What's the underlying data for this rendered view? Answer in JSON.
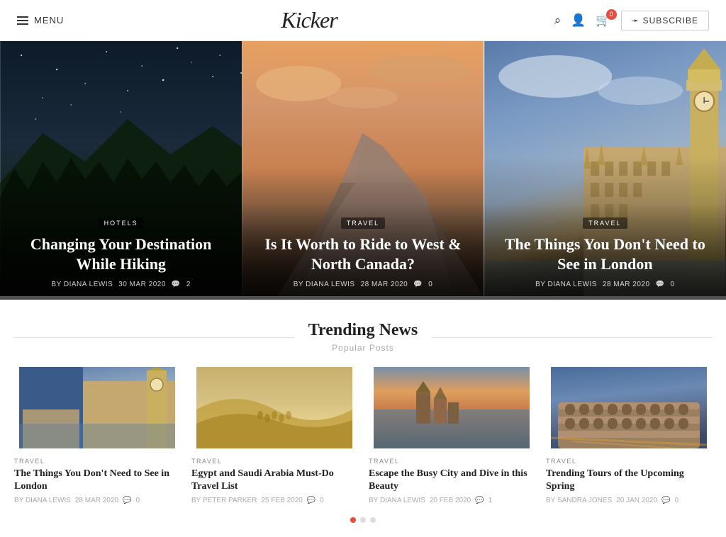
{
  "header": {
    "menu_label": "MENU",
    "logo": "Kicker",
    "subscribe_label": "SUBSCRIBE",
    "cart_count": "0"
  },
  "hero_cards": [
    {
      "tag": "HOTELS",
      "title": "Changing Your Destination While Hiking",
      "author": "BY DIANA LEWIS",
      "date": "30 MAR 2020",
      "comments": "2",
      "bg": "dark_forest"
    },
    {
      "tag": "TRAVEL",
      "title": "Is It Worth to Ride to West & North Canada?",
      "author": "BY DIANA LEWIS",
      "date": "28 MAR 2020",
      "comments": "0",
      "bg": "mountain"
    },
    {
      "tag": "TRAVEL",
      "title": "The Things You Don't Need to See in London",
      "author": "BY DIANA LEWIS",
      "date": "28 MAR 2020",
      "comments": "0",
      "bg": "london"
    }
  ],
  "trending": {
    "title": "Trending News",
    "subtitle": "Popular Posts",
    "cards": [
      {
        "tag": "TRAVEL",
        "title": "The Things You Don't Need to See in London",
        "author": "BY DIANA LEWIS",
        "date": "28 MAR 2020",
        "comments": "0",
        "bg": "london2"
      },
      {
        "tag": "TRAVEL",
        "title": "Egypt and Saudi Arabia Must-Do Travel List",
        "author": "BY PETER PARKER",
        "date": "25 FEB 2020",
        "comments": "0",
        "bg": "desert"
      },
      {
        "tag": "TRAVEL",
        "title": "Escape the Busy City and Dive in this Beauty",
        "author": "BY DIANA LEWIS",
        "date": "20 FEB 2020",
        "comments": "1",
        "bg": "coast"
      },
      {
        "tag": "TRAVEL",
        "title": "Trending Tours of the Upcoming Spring",
        "author": "BY SANDRA JONES",
        "date": "20 JAN 2020",
        "comments": "0",
        "bg": "colosseum"
      }
    ]
  },
  "pagination": {
    "active_dot": 0,
    "total_dots": 3
  }
}
